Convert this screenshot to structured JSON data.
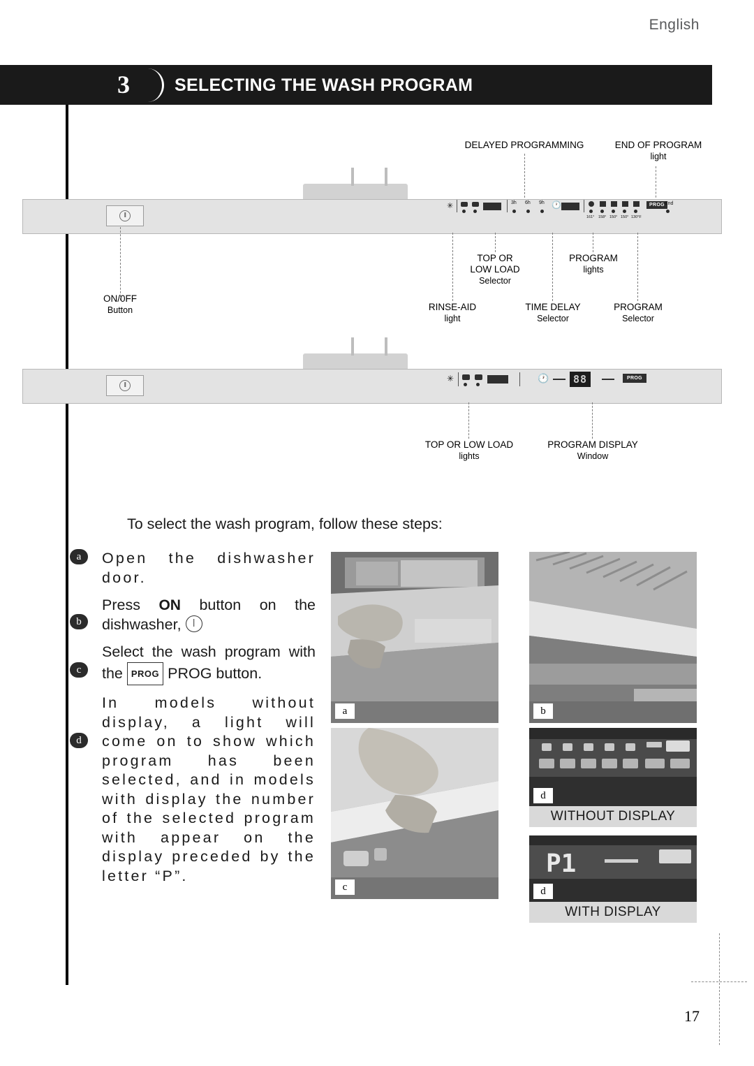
{
  "header": {
    "language": "English",
    "section_number": "3",
    "section_title": "SELECTING THE WASH PROGRAM"
  },
  "panel_top": {
    "callouts": {
      "delayed_programming": "DELAYED PROGRAMMING",
      "end_of_program": "END OF PROGRAM",
      "end_of_program_sub": "light",
      "top_or_low_load_1": "TOP OR",
      "top_or_low_load_2": "LOW LOAD",
      "top_or_low_load_sub": "Selector",
      "program_lights": "PROGRAM",
      "program_lights_sub": "lights",
      "onoff": "ON/0FF",
      "onoff_sub": "Button",
      "rinse_aid": "RINSE-AID",
      "rinse_aid_sub": "light",
      "time_delay": "TIME DELAY",
      "time_delay_sub": "Selector",
      "program_selector": "PROGRAM",
      "program_selector_sub": "Selector"
    },
    "controls": {
      "delay_marks": [
        "3h",
        "6h",
        "9h"
      ],
      "temp_marks": [
        "161°",
        "158°",
        "150°",
        "150°",
        "130°F"
      ],
      "prog_label": "PROG",
      "end_label": "End"
    }
  },
  "panel_bottom": {
    "callouts": {
      "top_or_low_load": "TOP OR LOW LOAD",
      "top_or_low_load_sub": "lights",
      "program_display": "PROGRAM DISPLAY",
      "program_display_sub": "Window"
    },
    "controls": {
      "display_value": "88",
      "prog_label": "PROG"
    }
  },
  "body": {
    "intro": "To select the wash program, follow these steps:",
    "steps": [
      {
        "tag": "a",
        "text": "Open the dishwasher door."
      },
      {
        "tag": "b",
        "text_1": "Press ",
        "bold": "ON",
        "text_2": " button on the dishwasher,",
        "icon": "on-button-icon"
      },
      {
        "tag": "c",
        "text_1": "Select the wash program with the ",
        "chip": "PROG",
        "text_2": " PROG button."
      },
      {
        "tag": "d",
        "text": "In models without display, a light will come on to show which program has been selected, and in models with display the number of the selected program with appear on the display preceded by the letter “P”."
      }
    ]
  },
  "photos": [
    {
      "tag": "a",
      "name": "photo-open-door"
    },
    {
      "tag": "b",
      "name": "photo-press-on"
    },
    {
      "tag": "c",
      "name": "photo-prog-button"
    },
    {
      "tag": "d",
      "name": "photo-without-display",
      "caption": "WITHOUT DISPLAY"
    },
    {
      "tag": "d",
      "name": "photo-with-display",
      "caption": "WITH DISPLAY",
      "display_text": "P1"
    }
  ],
  "footer": {
    "page_number": "17"
  }
}
